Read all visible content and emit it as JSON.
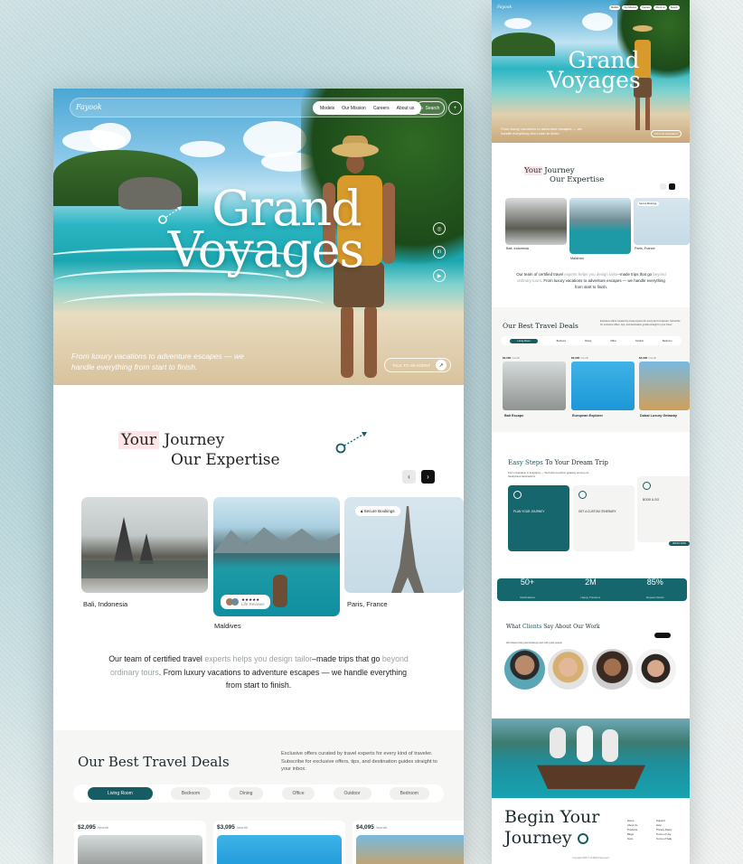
{
  "main": {
    "nav": {
      "logo": "Fayook",
      "links": [
        "Models",
        "Our Mission",
        "Careers",
        "About us"
      ],
      "search_label": "Search",
      "menu_icon": "plus-icon"
    },
    "hero": {
      "title_line1": "Grand",
      "title_line2": "Voyages",
      "copy": "From luxury vacations to adventure escapes — we handle everything from start to finish.",
      "cta": "TALK TO AN AGENT",
      "socials": [
        "instagram-icon",
        "linkedin-icon",
        "youtube-icon"
      ]
    },
    "journey": {
      "title_hl": "Your",
      "title_rest": " Journey",
      "title_line2": "Our Expertise"
    },
    "destinations": [
      {
        "label": "Bali, Indonesia"
      },
      {
        "label": "Maldives",
        "rating": "★★★★★",
        "rating_note": "Life Reviews"
      },
      {
        "label": "Paris, France",
        "badge": "Secure Bookings"
      }
    ],
    "description": {
      "part1": "Our team of certified travel ",
      "muted1": "experts helps you design tailor",
      "part2": "–made trips that go ",
      "muted2": "beyond ordinary tours",
      "part3": ". From luxury vacations to adventure escapes — we handle everything from start to finish."
    },
    "deals": {
      "title": "Our Best Travel Deals",
      "subtitle": "Exclusive offers curated by travel experts for every kind of traveler. Subscribe for exclusive offers, tips, and destination guides straight to your inbox.",
      "tabs": [
        "Living Room",
        "Bedroom",
        "Dining",
        "Office",
        "Outdoor",
        "Bedroom"
      ],
      "cards": [
        {
          "price": "$2,095",
          "unit": "/month"
        },
        {
          "price": "$3,095",
          "unit": "/month"
        },
        {
          "price": "$4,095",
          "unit": "/month"
        }
      ]
    }
  },
  "side": {
    "logo": "Fayook",
    "nav": [
      "Models",
      "Our Mission",
      "Careers",
      "About us",
      "Search"
    ],
    "title_line1": "Grand",
    "title_line2": "Voyages",
    "hero_copy": "From luxury vacations to adventure escapes — we handle everything from start to finish.",
    "cta": "TALK TO AN AGENT",
    "journey_hl": "Your",
    "journey_rest": " Journey",
    "journey_line2": "Our Expertise",
    "tiles": [
      "Bali, Indonesia",
      "Maldives",
      "Paris, France"
    ],
    "tile_badge": "Secure Bookings",
    "desc_p1": "Our team of certified travel ",
    "desc_m1": "experts helps you design tailor",
    "desc_p2": "–made trips that go ",
    "desc_m2": "beyond ordinary tours",
    "desc_p3": ". From luxury vacations to adventure escapes — we handle everything from start to finish.",
    "deals_title": "Our Best Travel Deals",
    "deals_sub": "Exclusive offers curated by travel experts for every kind of traveler. Subscribe for exclusive offers, tips, and destination guides straight to your inbox.",
    "deal_tabs": [
      "Living Room",
      "Bedroom",
      "Dining",
      "Office",
      "Outdoor",
      "Bedroom"
    ],
    "deals": [
      {
        "price": "$2,095",
        "unit": "/month",
        "name": "Bali Escape"
      },
      {
        "price": "$3,095",
        "unit": "/month",
        "name": "European Explorer"
      },
      {
        "price": "$4,095",
        "unit": "/month",
        "name": "Dubai Luxury Getaway"
      }
    ],
    "steps_title_a": "Easy Steps",
    "steps_title_b": " To Your Dream Trip",
    "steps_sub": "From inspiration to itineraries — We'll plan a perfect getaway among our handpicked destinations",
    "steps": [
      "PLAN YOUR JOURNEY",
      "GET A CUSTOM ITINERARY",
      "BOOK & GO"
    ],
    "book_now": "BOOK NOW",
    "stats": [
      {
        "value": "50+",
        "label": "Destinations"
      },
      {
        "value": "2M",
        "label": "Happy Travelers"
      },
      {
        "value": "85%",
        "label": "Repeat Clients"
      }
    ],
    "clients_title_a": "What ",
    "clients_title_hl": "Clients",
    "clients_title_b": " Say About Our Work",
    "clients_sub": "We believe that great bookings start with great people",
    "footer_title_line1": "Begin Your",
    "footer_title_line2": "Journey",
    "footer_links_a": [
      "Home",
      "About Us",
      "Products",
      "Blogs",
      "Docs"
    ],
    "footer_links_b": [
      "Support",
      "Help",
      "Privacy Policy",
      "Terms of Use",
      "Terms of Sale"
    ],
    "copyright": "Copyright 2025 © All Rights Reserved"
  },
  "colors": {
    "accent": "#155c63",
    "highlight": "#fde4e6",
    "sea": "#1aa6b0"
  }
}
